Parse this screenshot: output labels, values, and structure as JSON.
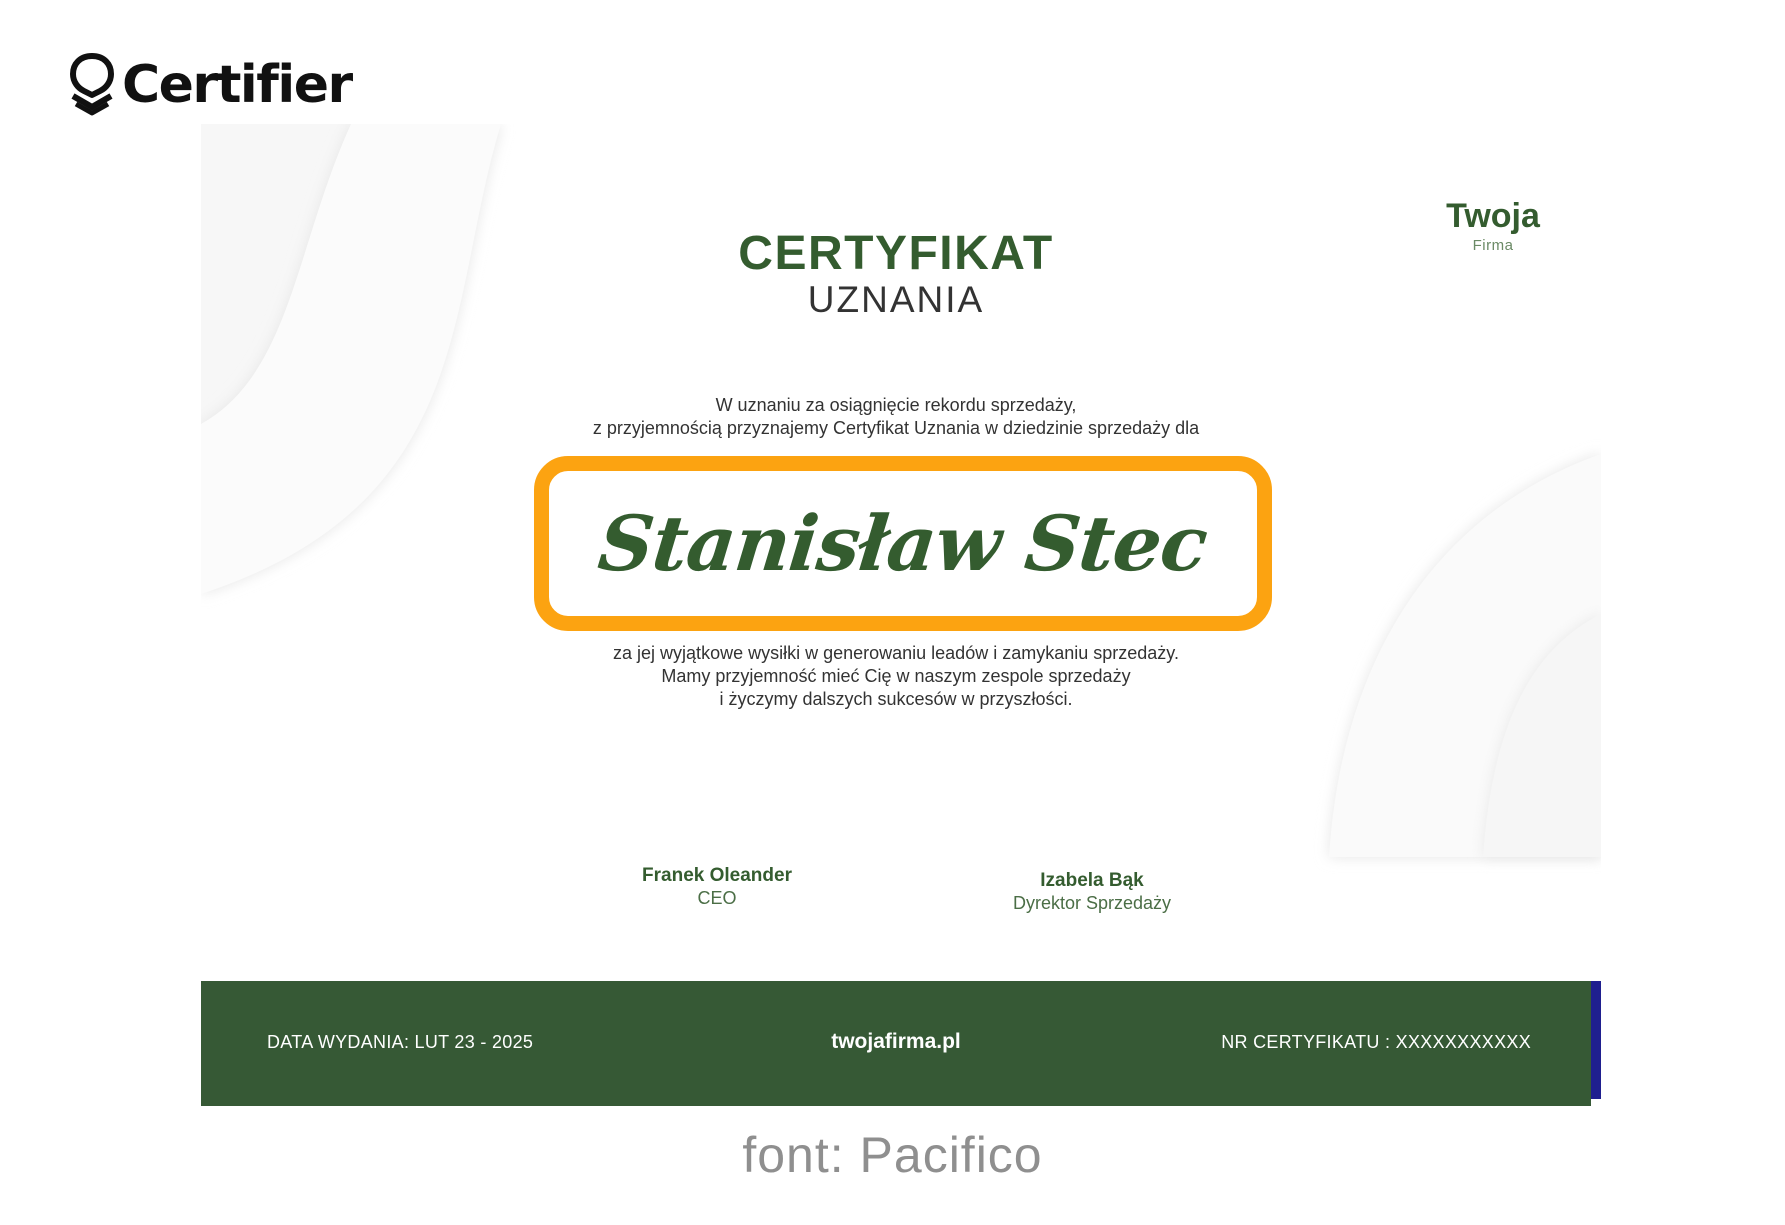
{
  "logo": {
    "text": "Certifier",
    "icon": "certifier-shield-icon"
  },
  "certificate": {
    "brand": {
      "name": "Twoja",
      "sub": "Firma"
    },
    "title": {
      "main": "CERTYFIKAT",
      "sub": "UZNANIA"
    },
    "intro": {
      "line1": "W uznaniu za osiągnięcie rekordu sprzedaży,",
      "line2": "z przyjemnością przyznajemy Certyfikat Uznania w dziedzinie sprzedaży dla"
    },
    "recipient": "Stanisław Stec",
    "body": {
      "line1": "za jej wyjątkowe wysiłki w generowaniu leadów i zamykaniu sprzedaży.",
      "line2": "Mamy przyjemność mieć Cię w naszym zespole sprzedaży",
      "line3": "i życzymy dalszych sukcesów w przyszłości."
    },
    "signatures": [
      {
        "name": "Franek Oleander",
        "role": "CEO"
      },
      {
        "name": "Izabela Bąk",
        "role": "Dyrektor Sprzedaży"
      }
    ],
    "footer": {
      "date": "DATA WYDANIA:  LUT 23 - 2025",
      "website": "twojafirma.pl",
      "cert_number": "NR CERTYFIKATU : XXXXXXXXXXX"
    }
  },
  "caption": "font: Pacifico",
  "colors": {
    "primary_green": "#345c2f",
    "footer_green": "#365935",
    "highlight_orange": "#fca311",
    "accent_blue": "#1f1f8f"
  }
}
